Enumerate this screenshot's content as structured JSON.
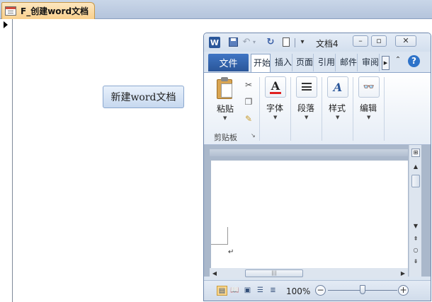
{
  "access": {
    "form_tab_title": "F_创建word文档",
    "button_label": "新建word文档"
  },
  "word": {
    "doc_title": "文档4",
    "logo_letter": "W",
    "file_tab": "文件",
    "ribbon_tabs": [
      "开始",
      "插入",
      "页面",
      "引用",
      "邮件",
      "审阅"
    ],
    "groups": {
      "paste": "粘贴",
      "clipboard": "剪贴板",
      "font": "字体",
      "paragraph": "段落",
      "styles": "样式",
      "editing": "编辑"
    },
    "zoom": {
      "text": "100%",
      "value": 100
    },
    "colors": {
      "file_tab": "#2a5699",
      "active_view": "#fcd88d"
    }
  }
}
